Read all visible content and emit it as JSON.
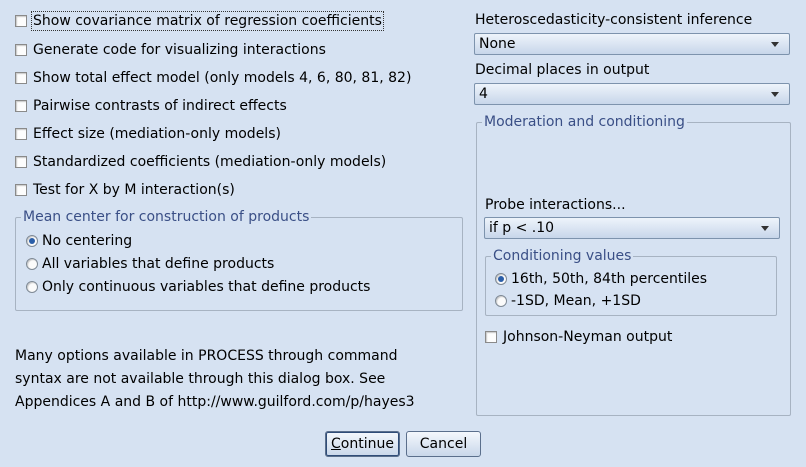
{
  "options": {
    "show_cov": "Show covariance matrix of regression coefficients",
    "gen_code": "Generate code for visualizing interactions",
    "total_effect": "Show total effect model (only models 4, 6, 80, 81, 82)",
    "pairwise": "Pairwise contrasts of indirect effects",
    "effect_size": "Effect size (mediation-only models)",
    "standardized": "Standardized coefficients (mediation-only models)",
    "xm_test": "Test for X by M interaction(s)"
  },
  "mean_center": {
    "legend": "Mean center for construction of products",
    "options": [
      "No centering",
      "All variables that define products",
      "Only continuous variables that define products"
    ],
    "selected": "No centering"
  },
  "note": {
    "line1": "Many options available in PROCESS through command",
    "line2": "syntax are not available through this dialog box.  See",
    "line3": "Appendices A and B of http://www.guilford.com/p/hayes3"
  },
  "hc": {
    "label": "Heteroscedasticity-consistent inference",
    "value": "None"
  },
  "decimals": {
    "label": "Decimal places in output",
    "value": "4"
  },
  "moderation": {
    "legend": "Moderation and conditioning",
    "probe_label": "Probe interactions...",
    "probe_value": "if p < .10",
    "conditioning": {
      "legend": "Conditioning values",
      "options": [
        "16th, 50th, 84th percentiles",
        "-1SD, Mean, +1SD"
      ],
      "selected": "16th, 50th, 84th percentiles"
    },
    "jn": "Johnson-Neyman output"
  },
  "buttons": {
    "continue": "Continue",
    "cancel": "Cancel"
  }
}
